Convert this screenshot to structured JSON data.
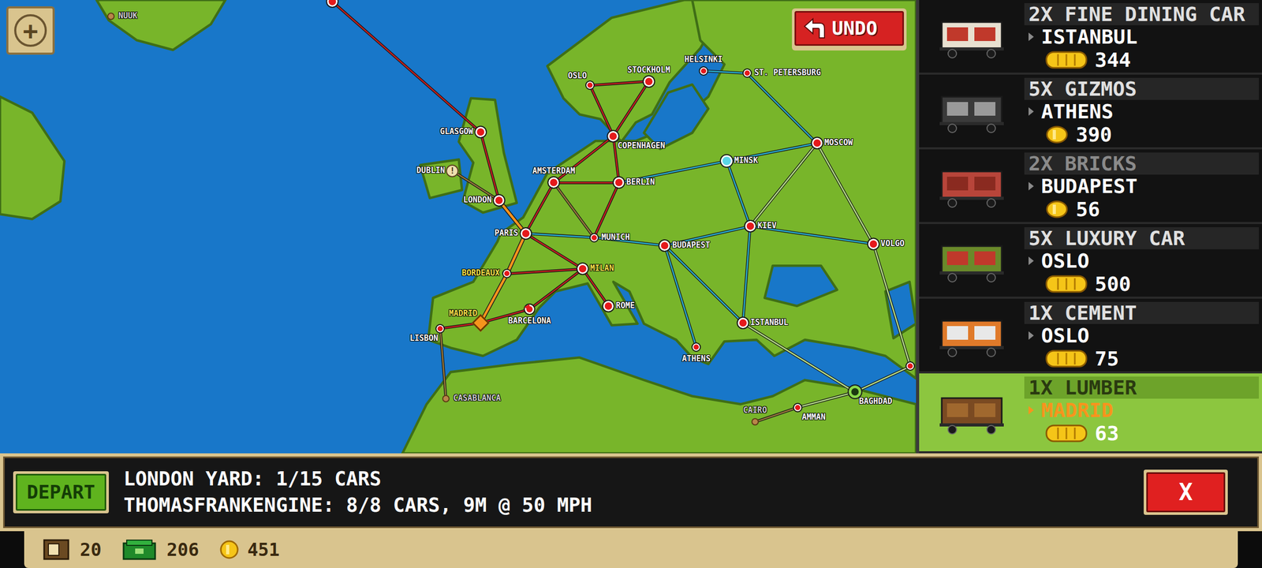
{
  "map": {
    "zoom_button": "+",
    "undo_button": "UNDO",
    "cities": [
      {
        "name": "NUUK",
        "kind": "unowned",
        "highlighted": false
      },
      {
        "name": "",
        "kind": "station",
        "highlighted": false
      },
      {
        "name": "GLASGOW",
        "kind": "station",
        "highlighted": false
      },
      {
        "name": "DUBLIN",
        "kind": "alert",
        "badge": "!",
        "highlighted": false
      },
      {
        "name": "LONDON",
        "kind": "station",
        "highlighted": false
      },
      {
        "name": "AMSTERDAM",
        "kind": "station",
        "highlighted": false
      },
      {
        "name": "BERLIN",
        "kind": "station",
        "highlighted": false
      },
      {
        "name": "OSLO",
        "kind": "small",
        "highlighted": false
      },
      {
        "name": "STOCKHOLM",
        "kind": "station",
        "highlighted": false
      },
      {
        "name": "COPENHAGEN",
        "kind": "station",
        "highlighted": false
      },
      {
        "name": "HELSINKI",
        "kind": "small",
        "highlighted": false
      },
      {
        "name": "ST. PETERSBURG",
        "kind": "small",
        "highlighted": false
      },
      {
        "name": "MOSCOW",
        "kind": "station",
        "highlighted": false
      },
      {
        "name": "MINSK",
        "kind": "cyan",
        "highlighted": false
      },
      {
        "name": "PARIS",
        "kind": "station",
        "highlighted": false
      },
      {
        "name": "MUNICH",
        "kind": "small",
        "highlighted": false
      },
      {
        "name": "BUDAPEST",
        "kind": "station",
        "highlighted": false
      },
      {
        "name": "KIEV",
        "kind": "station",
        "highlighted": false
      },
      {
        "name": "VOLGO",
        "kind": "station",
        "highlighted": false
      },
      {
        "name": "BORDEAUX",
        "kind": "small",
        "highlighted": true
      },
      {
        "name": "MILAN",
        "kind": "station",
        "highlighted": true
      },
      {
        "name": "ROME",
        "kind": "station",
        "highlighted": false
      },
      {
        "name": "MADRID",
        "kind": "current",
        "highlighted": true
      },
      {
        "name": "BARCELONA",
        "kind": "flag",
        "highlighted": false
      },
      {
        "name": "LISBON",
        "kind": "small",
        "highlighted": false
      },
      {
        "name": "ISTANBUL",
        "kind": "station",
        "highlighted": false
      },
      {
        "name": "ATHENS",
        "kind": "small",
        "highlighted": false
      },
      {
        "name": "CASABLANCA",
        "kind": "unowned",
        "highlighted": false
      },
      {
        "name": "CAIRO",
        "kind": "unowned",
        "highlighted": false
      },
      {
        "name": "AMMAN",
        "kind": "small",
        "highlighted": false
      },
      {
        "name": "BAGHDAD",
        "kind": "green",
        "highlighted": false
      },
      {
        "name": "",
        "kind": "small",
        "highlighted": false
      }
    ],
    "routes": [
      {
        "a": 1,
        "b": 2,
        "color": "#c81e1e"
      },
      {
        "a": 2,
        "b": 4,
        "color": "#c81e1e"
      },
      {
        "a": 5,
        "b": 6,
        "color": "#c81e1e"
      },
      {
        "a": 5,
        "b": 9,
        "color": "#c81e1e"
      },
      {
        "a": 9,
        "b": 7,
        "color": "#c81e1e"
      },
      {
        "a": 9,
        "b": 8,
        "color": "#c81e1e"
      },
      {
        "a": 7,
        "b": 8,
        "color": "#c81e1e"
      },
      {
        "a": 6,
        "b": 9,
        "color": "#c81e1e"
      },
      {
        "a": 6,
        "b": 15,
        "color": "#c81e1e"
      },
      {
        "a": 5,
        "b": 14,
        "color": "#c81e1e"
      },
      {
        "a": 14,
        "b": 20,
        "color": "#c81e1e"
      },
      {
        "a": 20,
        "b": 21,
        "color": "#c81e1e"
      },
      {
        "a": 20,
        "b": 23,
        "color": "#c81e1e"
      },
      {
        "a": 19,
        "b": 20,
        "color": "#c81e1e"
      },
      {
        "a": 22,
        "b": 23,
        "color": "#c81e1e"
      },
      {
        "a": 22,
        "b": 24,
        "color": "#c81e1e"
      },
      {
        "a": 4,
        "b": 14,
        "color": "#f7941d"
      },
      {
        "a": 14,
        "b": 19,
        "color": "#f7941d"
      },
      {
        "a": 19,
        "b": 22,
        "color": "#f7941d"
      },
      {
        "a": 10,
        "b": 11,
        "color": "#2ab0d0"
      },
      {
        "a": 11,
        "b": 12,
        "color": "#2ab0d0"
      },
      {
        "a": 6,
        "b": 13,
        "color": "#2ab0d0"
      },
      {
        "a": 13,
        "b": 12,
        "color": "#2ab0d0"
      },
      {
        "a": 13,
        "b": 17,
        "color": "#2ab0d0"
      },
      {
        "a": 14,
        "b": 15,
        "color": "#2ab0d0"
      },
      {
        "a": 15,
        "b": 16,
        "color": "#2ab0d0"
      },
      {
        "a": 16,
        "b": 17,
        "color": "#2ab0d0"
      },
      {
        "a": 17,
        "b": 18,
        "color": "#2ab0d0"
      },
      {
        "a": 16,
        "b": 26,
        "color": "#2ab0d0"
      },
      {
        "a": 17,
        "b": 25,
        "color": "#2ab0d0"
      },
      {
        "a": 16,
        "b": 25,
        "color": "#2ab0d0"
      },
      {
        "a": 12,
        "b": 18,
        "color": "#b8e08a"
      },
      {
        "a": 12,
        "b": 17,
        "color": "#b8e08a"
      },
      {
        "a": 25,
        "b": 30,
        "color": "#b8e08a"
      },
      {
        "a": 29,
        "b": 30,
        "color": "#b8e08a"
      },
      {
        "a": 18,
        "b": 31,
        "color": "#b8e08a"
      },
      {
        "a": 30,
        "b": 31,
        "color": "#b8e08a"
      },
      {
        "a": 24,
        "b": 27,
        "color": "#9a7a3a"
      },
      {
        "a": 28,
        "b": 29,
        "color": "#9a7a3a"
      },
      {
        "a": 3,
        "b": 4,
        "color": "#9a7a3a"
      },
      {
        "a": 5,
        "b": 15,
        "color": "#9a7a3a"
      }
    ]
  },
  "cargo": [
    {
      "title": "2X FINE DINING CAR",
      "destination": "ISTANBUL",
      "value": "344",
      "coin": "stack",
      "dimmed": false,
      "selected": false
    },
    {
      "title": "5X GIZMOS",
      "destination": "ATHENS",
      "value": "390",
      "coin": "coin",
      "dimmed": false,
      "selected": false
    },
    {
      "title": "2X BRICKS",
      "destination": "BUDAPEST",
      "value": "56",
      "coin": "coin",
      "dimmed": true,
      "selected": false
    },
    {
      "title": "5X LUXURY CAR",
      "destination": "OSLO",
      "value": "500",
      "coin": "stack",
      "dimmed": false,
      "selected": false
    },
    {
      "title": "1X CEMENT",
      "destination": "OSLO",
      "value": "75",
      "coin": "stack",
      "dimmed": false,
      "selected": false
    },
    {
      "title": "1X LUMBER",
      "destination": "MADRID",
      "value": "63",
      "coin": "stack",
      "dimmed": false,
      "selected": true
    }
  ],
  "bottom_bar": {
    "depart_button": "DEPART",
    "yard": "LONDON YARD: 1/15 CARS",
    "engine": "THOMASFRANKENGINE: 8/8 CARS, 9M @ 50 MPH",
    "close_button": "X"
  },
  "status_bar": {
    "crates": "20",
    "cash": "206",
    "coins": "451"
  }
}
